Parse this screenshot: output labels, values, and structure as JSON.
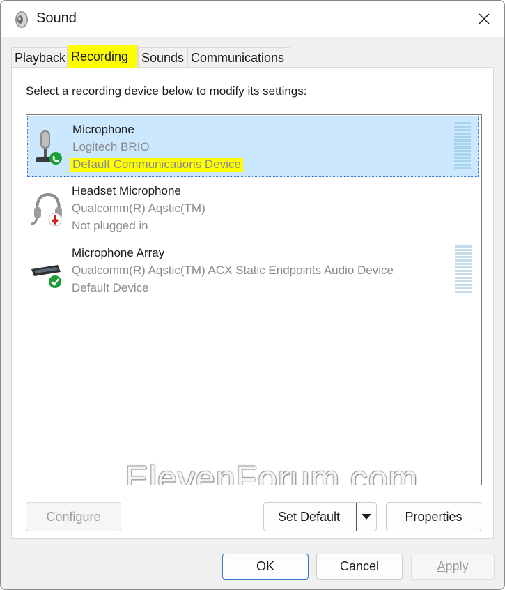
{
  "window": {
    "title": "Sound"
  },
  "tabs": [
    {
      "label": "Playback"
    },
    {
      "label": "Recording"
    },
    {
      "label": "Sounds"
    },
    {
      "label": "Communications"
    }
  ],
  "instruction": "Select a recording device below to modify its settings:",
  "devices": [
    {
      "name": "Microphone",
      "subtitle": "Logitech BRIO",
      "status": "Default Communications Device",
      "icon": "webcam-microphone-icon",
      "badge": "phone-badge-icon"
    },
    {
      "name": "Headset Microphone",
      "subtitle": "Qualcomm(R) Aqstic(TM)",
      "status": "Not plugged in",
      "icon": "headset-icon",
      "badge": "unplugged-badge-icon"
    },
    {
      "name": "Microphone Array",
      "subtitle": "Qualcomm(R) Aqstic(TM) ACX Static Endpoints Audio Device",
      "status": "Default Device",
      "icon": "microphone-array-icon",
      "badge": "check-badge-icon"
    }
  ],
  "watermark": "ElevenForum.com",
  "buttons": {
    "configure": {
      "pre": "",
      "u": "C",
      "post": "onfigure"
    },
    "set_default": {
      "pre": "",
      "u": "S",
      "post": "et Default"
    },
    "properties": {
      "pre": "",
      "u": "P",
      "post": "roperties"
    },
    "ok": "OK",
    "cancel": "Cancel",
    "apply": {
      "pre": "",
      "u": "A",
      "post": "pply"
    }
  },
  "colors": {
    "accent": "#3b78c6",
    "selected_bg": "#cce8ff",
    "highlight": "#ffff00",
    "badge_green": "#1e9e3a",
    "badge_red": "#d01c1c"
  }
}
